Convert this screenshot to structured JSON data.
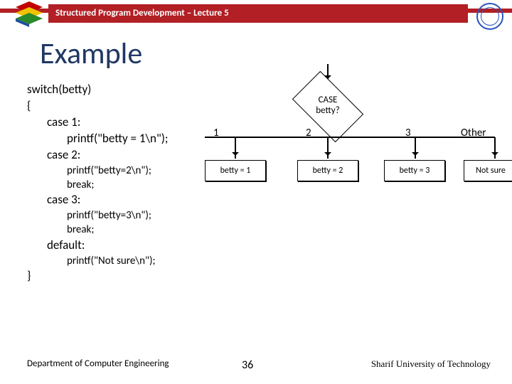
{
  "header": {
    "title": "Structured Program Development – Lecture 5"
  },
  "slide_title": "Example",
  "code": {
    "l1": "switch(betty)",
    "l2": "{",
    "l3": "case 1:",
    "l4": "printf(\"betty = 1\\n\");",
    "l5": "case 2:",
    "l6": "printf(\"betty=2\\n\");",
    "l7": "break;",
    "l8": "case 3:",
    "l9": "printf(\"betty=3\\n\");",
    "l10": "break;",
    "l11": "default:",
    "l12": "printf(\"Not sure\\n\");",
    "l13": "}"
  },
  "flow": {
    "diamond_l1": "CASE",
    "diamond_l2": "betty?",
    "branch1": "1",
    "branch2": "2",
    "branch3": "3",
    "branch4": "Other",
    "box1": "betty = 1",
    "box2": "betty = 2",
    "box3": "betty = 3",
    "box4": "Not sure"
  },
  "footer": {
    "left": "Department of Computer Engineering",
    "page": "36",
    "right": "Sharif University of Technology"
  }
}
